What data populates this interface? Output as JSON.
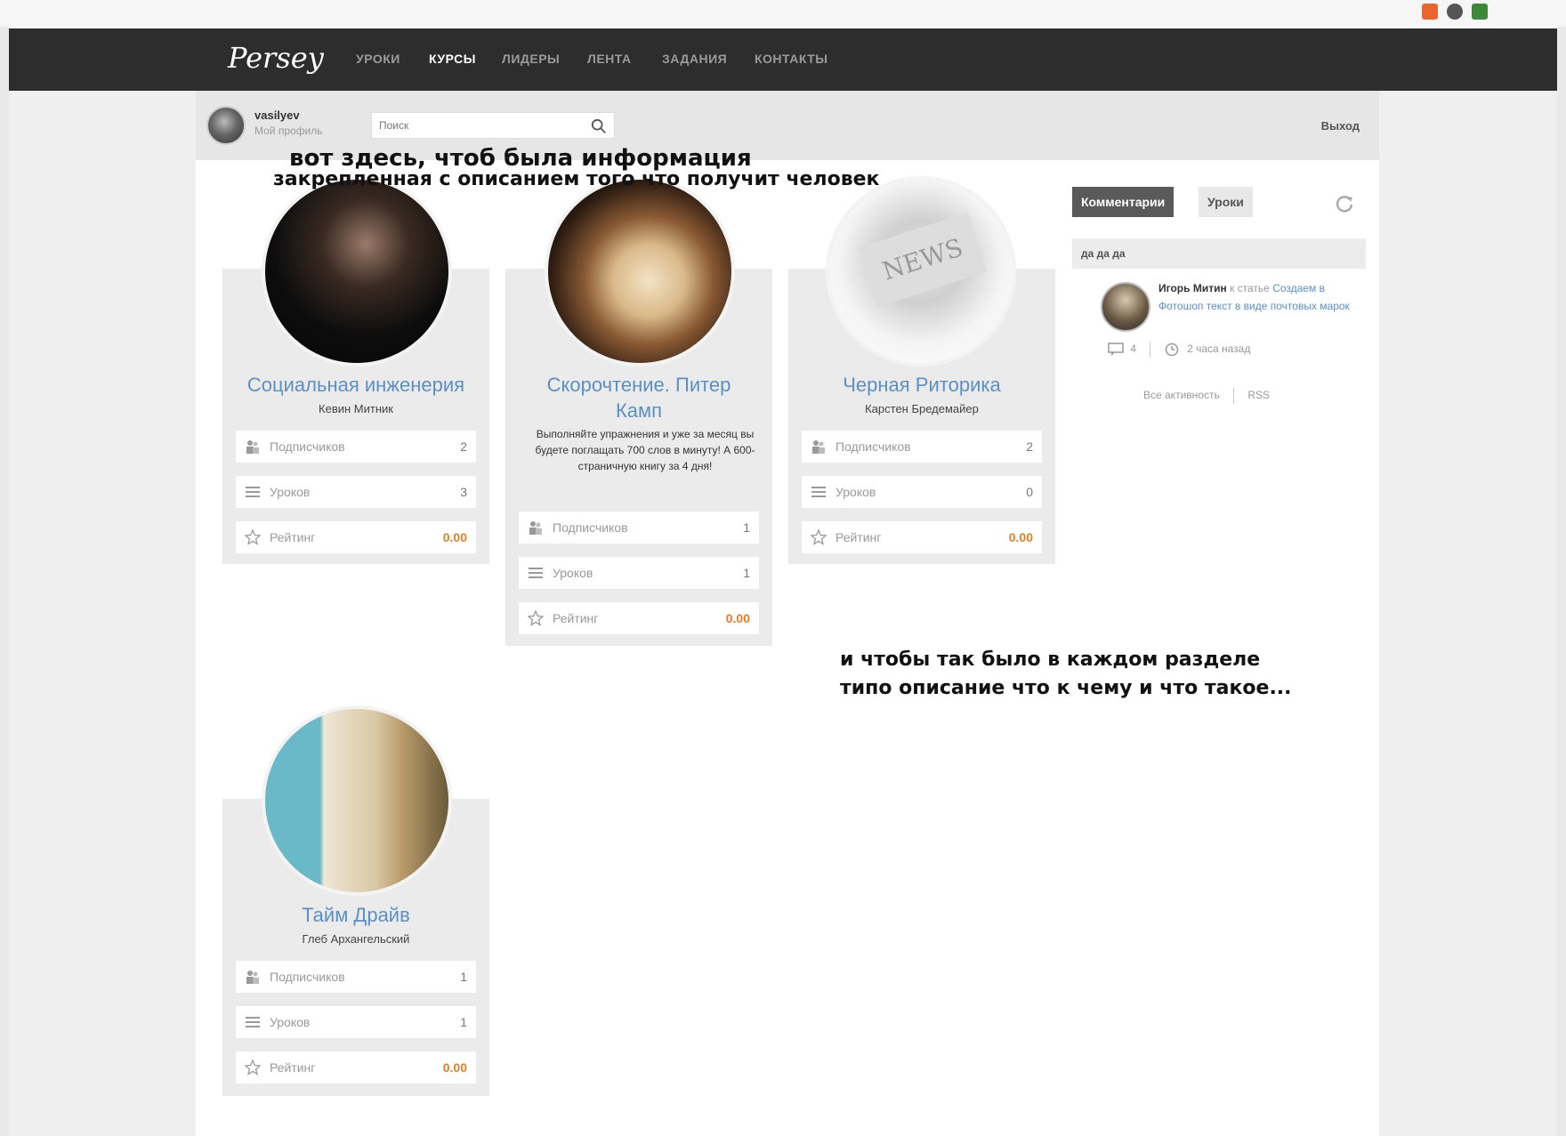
{
  "browser": {
    "url": ""
  },
  "nav": {
    "logo": "Persey",
    "items": [
      {
        "label": "УРОКИ",
        "active": false
      },
      {
        "label": "КУРСЫ",
        "active": true
      },
      {
        "label": "ЛИДЕРЫ",
        "active": false
      },
      {
        "label": "ЛЕНТА",
        "active": false
      },
      {
        "label": "ЗАДАНИЯ",
        "active": false
      },
      {
        "label": "КОНТАКТЫ",
        "active": false
      }
    ]
  },
  "user": {
    "name": "vasilyev",
    "profile_link": "Мой профиль"
  },
  "search": {
    "placeholder": "Поиск"
  },
  "logout_label": "Выход",
  "annotations": {
    "top_line1": "вот здесь, чтоб была информация",
    "top_line2": "закрепленная с описанием того что получит человек",
    "bottom_line1": "и чтобы так было в каждом разделе",
    "bottom_line2": "типо описание что к чему и что такое..."
  },
  "stat_labels": {
    "subscribers": "Подписчиков",
    "lessons": "Уроков",
    "rating": "Рейтинг"
  },
  "courses": [
    {
      "title": "Социальная инженерия",
      "author": "Кевин Митник",
      "description": "",
      "subscribers": "2",
      "lessons": "3",
      "rating": "0.00"
    },
    {
      "title": "Скорочтение. Питер Камп",
      "author": "",
      "description": "Выполняйте упражнения и уже за месяц вы будете поглащать 700 слов в минуту! А 600-страничную книгу за 4 дня!",
      "subscribers": "1",
      "lessons": "1",
      "rating": "0.00"
    },
    {
      "title": "Черная Риторика",
      "author": "Карстен Бредемайер",
      "description": "",
      "subscribers": "2",
      "lessons": "0",
      "rating": "0.00"
    },
    {
      "title": "Тайм Драйв",
      "author": "Глеб Архангельский",
      "description": "",
      "subscribers": "1",
      "lessons": "1",
      "rating": "0.00"
    }
  ],
  "widget": {
    "tabs": [
      {
        "label": "Комментарии",
        "active": true
      },
      {
        "label": "Уроки",
        "active": false
      }
    ],
    "feed_header": "да да да",
    "item": {
      "user": "Игорь Митин",
      "action": "к статье",
      "link": "Создаем в Фотошоп текст в виде почтовых марок",
      "comments": "4",
      "time": "2 часа назад"
    },
    "footer_all": "Все активность",
    "footer_rss": "RSS"
  },
  "colors": {
    "accent": "#5b8fc8",
    "rating": "#e67e22",
    "nav_bg": "#2d2d2d"
  }
}
